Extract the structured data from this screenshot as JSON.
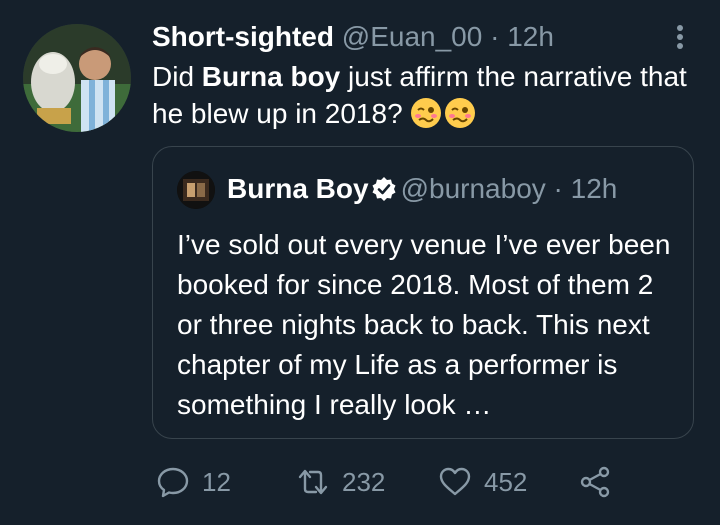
{
  "tweet": {
    "display_name": "Short-sighted",
    "handle": "@Euan_00",
    "separator": "·",
    "time": "12h",
    "text_before": "Did ",
    "text_bold": "Burna boy",
    "text_after": " just affirm the narrative that he blew up in 2018?",
    "emoji": "woozy-face-emoji"
  },
  "quote": {
    "display_name": "Burna Boy",
    "handle": "@burnaboy",
    "separator": "·",
    "time": "12h",
    "text": "I’ve sold out every venue I’ve ever been booked for since 2018. Most of them 2 or three nights back to back. This next chapter of my Life as a performer is something I really look …"
  },
  "actions": {
    "reply_count": "12",
    "retweet_count": "232",
    "like_count": "452"
  },
  "colors": {
    "background": "#15202b",
    "muted": "#8899a6",
    "border": "#38444d",
    "verified": "#ffffff"
  }
}
